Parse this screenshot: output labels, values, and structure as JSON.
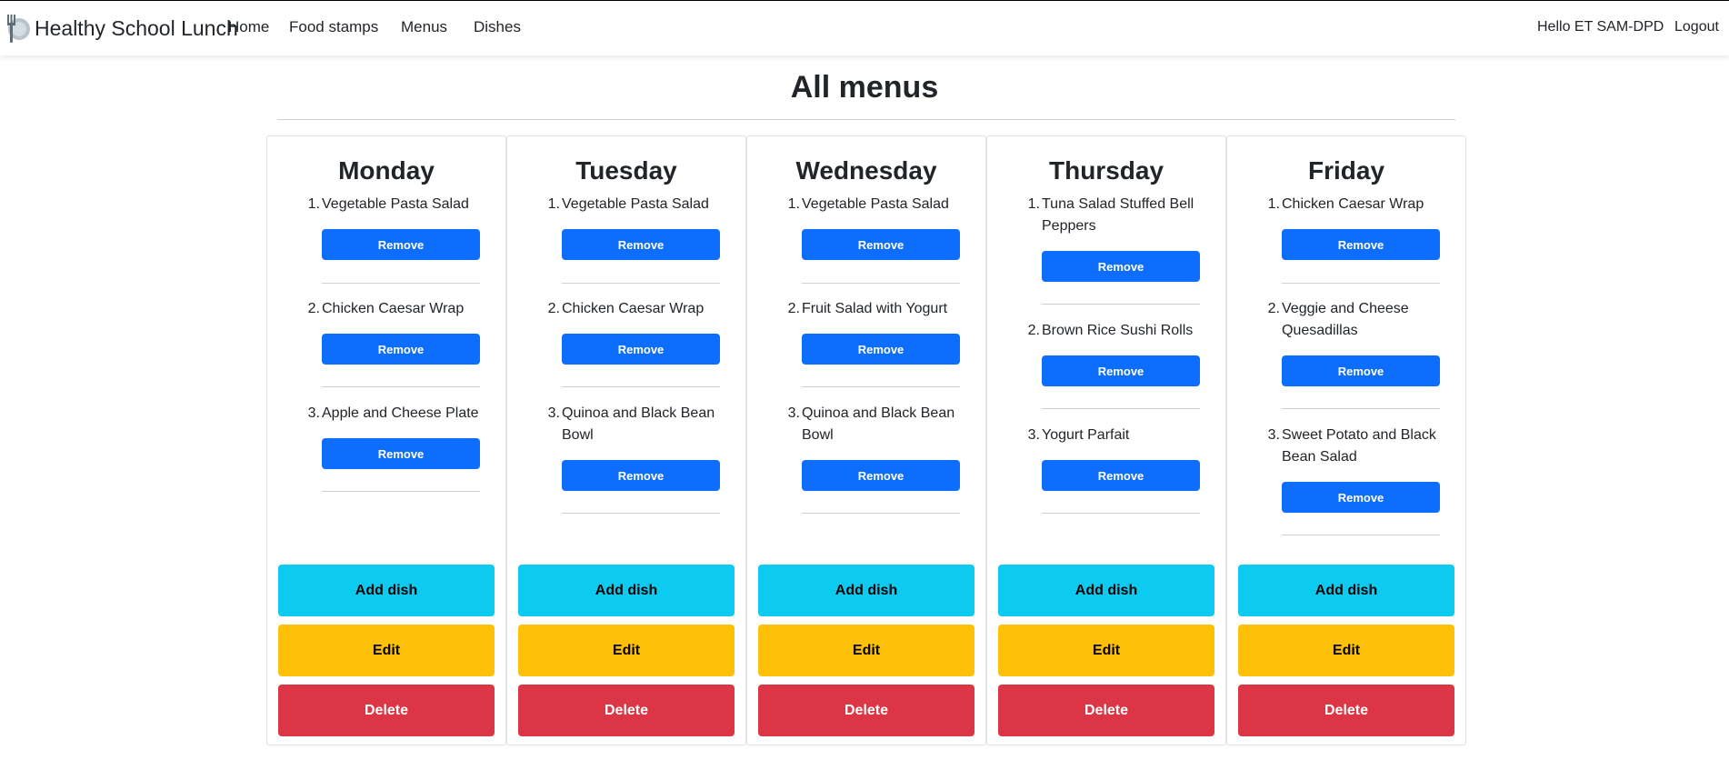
{
  "navbar": {
    "brand": "Healthy School Lunch",
    "links": [
      "Home",
      "Food stamps",
      "Menus",
      "Dishes"
    ],
    "greeting": "Hello ET SAM-DPD",
    "logout": "Logout"
  },
  "page": {
    "title": "All menus"
  },
  "buttons": {
    "remove": "Remove",
    "add": "Add dish",
    "edit": "Edit",
    "delete": "Delete"
  },
  "menus": [
    {
      "day": "Monday",
      "dishes": [
        {
          "num": "1.",
          "name": "Vegetable Pasta Salad"
        },
        {
          "num": "2.",
          "name": "Chicken Caesar Wrap"
        },
        {
          "num": "3.",
          "name": "Apple and Cheese Plate"
        }
      ]
    },
    {
      "day": "Tuesday",
      "dishes": [
        {
          "num": "1.",
          "name": "Vegetable Pasta Salad"
        },
        {
          "num": "2.",
          "name": "Chicken Caesar Wrap"
        },
        {
          "num": "3.",
          "name": "Quinoa and Black Bean Bowl"
        }
      ]
    },
    {
      "day": "Wednesday",
      "dishes": [
        {
          "num": "1.",
          "name": "Vegetable Pasta Salad"
        },
        {
          "num": "2.",
          "name": "Fruit Salad with Yogurt"
        },
        {
          "num": "3.",
          "name": "Quinoa and Black Bean Bowl"
        }
      ]
    },
    {
      "day": "Thursday",
      "dishes": [
        {
          "num": "1.",
          "name": "Tuna Salad Stuffed Bell Peppers"
        },
        {
          "num": "2.",
          "name": "Brown Rice Sushi Rolls"
        },
        {
          "num": "3.",
          "name": "Yogurt Parfait"
        }
      ]
    },
    {
      "day": "Friday",
      "dishes": [
        {
          "num": "1.",
          "name": "Chicken Caesar Wrap"
        },
        {
          "num": "2.",
          "name": "Veggie and Cheese Quesadillas"
        },
        {
          "num": "3.",
          "name": "Sweet Potato and Black Bean Salad"
        }
      ]
    }
  ]
}
